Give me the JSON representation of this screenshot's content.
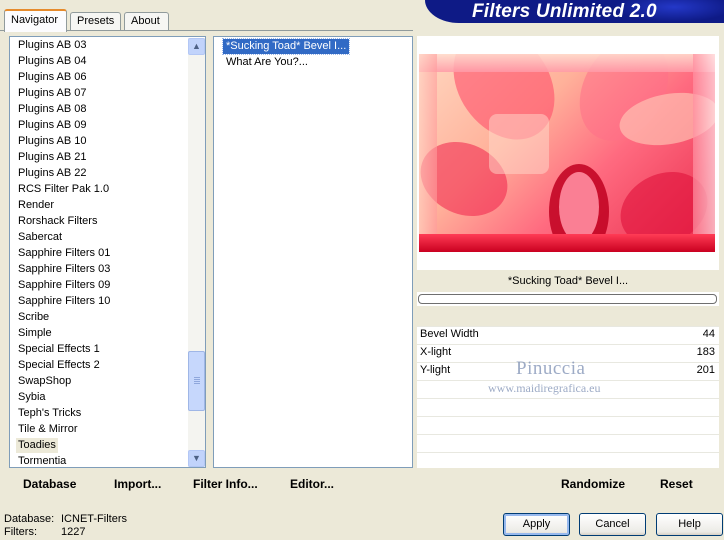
{
  "banner": {
    "title": "Filters Unlimited 2.0"
  },
  "tabs": [
    {
      "label": "Navigator",
      "active": true
    },
    {
      "label": "Presets",
      "active": false
    },
    {
      "label": "About",
      "active": false
    }
  ],
  "categories": {
    "items": [
      "Plugins AB 03",
      "Plugins AB 04",
      "Plugins AB 06",
      "Plugins AB 07",
      "Plugins AB 08",
      "Plugins AB 09",
      "Plugins AB 10",
      "Plugins AB 21",
      "Plugins AB 22",
      "RCS Filter Pak 1.0",
      "Render",
      "Rorshack Filters",
      "Sabercat",
      "Sapphire Filters 01",
      "Sapphire Filters 03",
      "Sapphire Filters 09",
      "Sapphire Filters 10",
      "Scribe",
      "Simple",
      "Special Effects 1",
      "Special Effects 2",
      "SwapShop",
      "Sybia",
      "Teph's Tricks",
      "Tile & Mirror",
      "Toadies",
      "Tormentia"
    ],
    "selected": "Toadies"
  },
  "filters": {
    "items": [
      "*Sucking Toad*  Bevel I...",
      "What Are You?..."
    ],
    "selected": "*Sucking Toad*  Bevel I..."
  },
  "preview": {
    "filter_name": "*Sucking Toad*  Bevel I...",
    "progress": 0
  },
  "params": [
    {
      "label": "Bevel Width",
      "value": "44"
    },
    {
      "label": "X-light",
      "value": "183"
    },
    {
      "label": "Y-light",
      "value": "201"
    }
  ],
  "watermark": {
    "title": "Pinuccia",
    "url": "www.maidiregrafica.eu"
  },
  "toolbar": {
    "database": "Database",
    "import": "Import...",
    "filter_info": "Filter Info...",
    "editor": "Editor...",
    "randomize": "Randomize",
    "reset": "Reset"
  },
  "status": {
    "database_label": "Database:",
    "database_value": "ICNET-Filters",
    "filters_label": "Filters:",
    "filters_value": "1227"
  },
  "buttons": {
    "apply": "Apply",
    "cancel": "Cancel",
    "help": "Help"
  },
  "colors": {
    "banner": "#0e1a86",
    "selection": "#316ac5",
    "window_bg": "#ece9d8"
  }
}
